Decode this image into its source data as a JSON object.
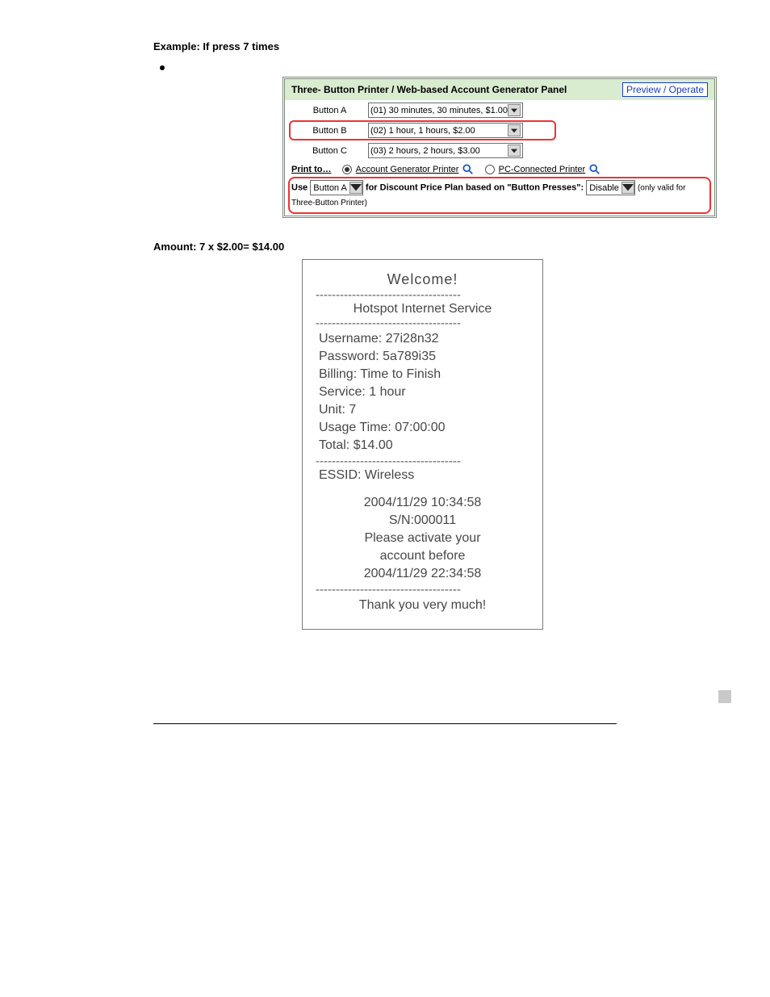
{
  "heading_example": "Example: If press 7 times",
  "panel": {
    "title": "Three- Button Printer / Web-based Account Generator Panel",
    "preview_label": "Preview / Operate",
    "rows": [
      {
        "label": "Button A",
        "option": "(01) 30 minutes, 30 minutes, $1.00"
      },
      {
        "label": "Button B",
        "option": "(02) 1 hour, 1 hours, $2.00"
      },
      {
        "label": "Button C",
        "option": "(03) 2 hours, 2 hours, $3.00"
      }
    ],
    "print_to_label": "Print to…",
    "print_options": {
      "acct_printer": "Account Generator Printer",
      "pc_printer": "PC-Connected Printer"
    },
    "discount": {
      "use": "Use",
      "button_sel": "Button A",
      "mid": "for Discount Price Plan based on \"Button Presses\":",
      "disable_sel": "Disable",
      "note": "(only valid for Three-Button Printer)"
    }
  },
  "amount_line": "Amount: 7 x $2.00= $14.00",
  "receipt": {
    "welcome": "Welcome!",
    "service": "Hotspot Internet Service",
    "username": "Username:  27i28n32",
    "password": "Password:  5a789i35",
    "billing": "Billing: Time to Finish",
    "svc": "Service: 1 hour",
    "unit": "Unit: 7",
    "usage": "Usage Time: 07:00:00",
    "total": "Total: $14.00",
    "essid": "ESSID: Wireless",
    "ts": "2004/11/29 10:34:58",
    "sn": "S/N:000011",
    "act1": "Please activate your",
    "act2": "account before",
    "act3": "2004/11/29 22:34:58",
    "thanks": "Thank you very much!"
  },
  "dash_line": "------------------------------------"
}
